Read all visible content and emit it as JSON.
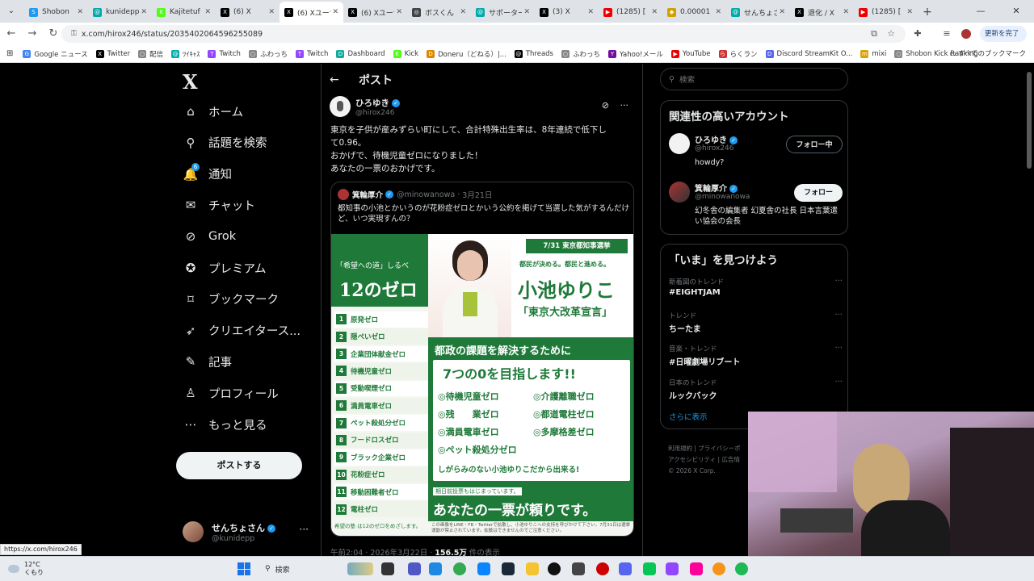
{
  "browser": {
    "tabs": [
      {
        "label": "Shobon",
        "color": "#1d9bf0",
        "glyph": "S"
      },
      {
        "label": "kunidepp",
        "color": "#0aa",
        "glyph": "@"
      },
      {
        "label": "Kajitetuf",
        "color": "#53fc18",
        "glyph": "K"
      },
      {
        "label": "(6) X",
        "color": "#000",
        "glyph": "X"
      },
      {
        "label": "(6) Xユーザ",
        "color": "#000",
        "glyph": "X"
      },
      {
        "label": "(6) Xユーザ",
        "color": "#000",
        "glyph": "X"
      },
      {
        "label": "ボスくん",
        "color": "#444",
        "glyph": "◎"
      },
      {
        "label": "サポーター",
        "color": "#0aa",
        "glyph": "@"
      },
      {
        "label": "(3) X",
        "color": "#000",
        "glyph": "X"
      },
      {
        "label": "(1285) [",
        "color": "#e00",
        "glyph": "▶"
      },
      {
        "label": "0.00001",
        "color": "#d4a000",
        "glyph": "◆"
      },
      {
        "label": "せんちょさ",
        "color": "#0aa",
        "glyph": "@"
      },
      {
        "label": "退化 / X",
        "color": "#000",
        "glyph": "X"
      },
      {
        "label": "(1285) [",
        "color": "#e00",
        "glyph": "▶"
      }
    ],
    "active_tab": 4,
    "url": "x.com/hirox246/status/2035402064596255089",
    "update_label": "更新を完了",
    "bookmarks": [
      {
        "label": "Google ニュース",
        "color": "#4285f4",
        "glyph": "G"
      },
      {
        "label": "Twitter",
        "color": "#000",
        "glyph": "X"
      },
      {
        "label": "配信",
        "color": "#888",
        "glyph": "○"
      },
      {
        "label": "ﾂｲｷｬｽ",
        "color": "#0aa",
        "glyph": "@"
      },
      {
        "label": "Twitch",
        "color": "#9146ff",
        "glyph": "T"
      },
      {
        "label": "ふわっち",
        "color": "#888",
        "glyph": "○"
      },
      {
        "label": "Twitch",
        "color": "#9146ff",
        "glyph": "T"
      },
      {
        "label": "Dashboard",
        "color": "#1a9",
        "glyph": "D"
      },
      {
        "label": "Kick",
        "color": "#53fc18",
        "glyph": "K"
      },
      {
        "label": "Doneru（どねる）|...",
        "color": "#d80",
        "glyph": "D"
      },
      {
        "label": "Threads",
        "color": "#000",
        "glyph": "@"
      },
      {
        "label": "ふわっち",
        "color": "#888",
        "glyph": "○"
      },
      {
        "label": "Yahoo!メール",
        "color": "#720e9e",
        "glyph": "Y"
      },
      {
        "label": "YouTube",
        "color": "#e00",
        "glyph": "▶"
      },
      {
        "label": "らくラン",
        "color": "#c33",
        "glyph": "ら"
      },
      {
        "label": "Discord StreamKit O...",
        "color": "#5865f2",
        "glyph": "D"
      },
      {
        "label": "mixi",
        "color": "#d8a200",
        "glyph": "m"
      },
      {
        "label": "Shobon Kick Ranking",
        "color": "#888",
        "glyph": "○"
      }
    ],
    "all_bookmarks": "すべてのブックマーク",
    "status_url": "https://x.com/hirox246"
  },
  "sidebar": {
    "logo": "X",
    "items": [
      {
        "label": "ホーム",
        "icon": "home-icon",
        "glyph": "⌂"
      },
      {
        "label": "話題を検索",
        "icon": "search-icon",
        "glyph": "⚲"
      },
      {
        "label": "通知",
        "icon": "bell-icon",
        "glyph": "🔔",
        "badge": "6"
      },
      {
        "label": "チャット",
        "icon": "mail-icon",
        "glyph": "✉"
      },
      {
        "label": "Grok",
        "icon": "grok-icon",
        "glyph": "⊘"
      },
      {
        "label": "プレミアム",
        "icon": "premium-icon",
        "glyph": "✪"
      },
      {
        "label": "ブックマーク",
        "icon": "bookmark-icon",
        "glyph": "⌑"
      },
      {
        "label": "クリエイタース...",
        "icon": "rocket-icon",
        "glyph": "➶"
      },
      {
        "label": "記事",
        "icon": "article-icon",
        "glyph": "✎"
      },
      {
        "label": "プロフィール",
        "icon": "profile-icon",
        "glyph": "♙"
      },
      {
        "label": "もっと見る",
        "icon": "more-circle-icon",
        "glyph": "⋯"
      }
    ],
    "post_button": "ポストする",
    "account": {
      "name": "せんちょさん",
      "handle": "@kunidepp"
    }
  },
  "post": {
    "header": "ポスト",
    "author": {
      "name": "ひろゆき",
      "handle": "@hirox246"
    },
    "lines": [
      "東京を子供が産みずらい町にして、合計特殊出生率は、8年連続で低下し",
      "て0.96。",
      "おかげで、待機児童ゼロになりました！",
      "あなたの一票のおかげです。"
    ],
    "quote": {
      "author": {
        "name": "箕輪厚介",
        "handle": "@minowanowa",
        "date": "3月21日"
      },
      "text": "都知事の小池とかいうのが花粉症ゼロとかいう公約を掲げて当選した気がするんだけど、いつ実現すんの？",
      "poster": {
        "left_tag": "「希望への道」しるべ",
        "left_title": "12のゼロ",
        "zeros": [
          "原発ゼロ",
          "隠ぺいゼロ",
          "企業団体献金ゼロ",
          "待機児童ゼロ",
          "受動喫煙ゼロ",
          "満員電車ゼロ",
          "ペット殺処分ゼロ",
          "フードロスゼロ",
          "ブラック企業ゼロ",
          "花粉症ゼロ",
          "移動困難者ゼロ",
          "電柱ゼロ"
        ],
        "left_footer": "希望の塾 は12のゼロをめざします。",
        "election": "7/31 東京都知事選挙",
        "slogan": "都民が決める。都民と進める。",
        "candidate": "小池ゆりこ",
        "declaration": "「東京大改革宣言」",
        "mission": "都政の課題を解決するために",
        "seven": "7つの0を目指します!!",
        "seven_zeros": [
          "◎待機児童ゼロ",
          "◎介護離職ゼロ",
          "◎残　　業ゼロ",
          "◎都道電柱ゼロ",
          "◎満員電車ゼロ",
          "◎多摩格差ゼロ",
          "◎ペット殺処分ゼロ"
        ],
        "tagline": "しがらみのない小池ゆりこだから出来る!",
        "early_vote": "期日前投票もはじまっています。",
        "vote": "あなたの一票が頼りです。",
        "small_note": "この画像をLINE・FB・Twitterで拡散し、小池ゆりこへの支持を呼びかけて下さい。7月31日は選挙運動が禁止されています。拡散はできませんのでご注意ください。"
      }
    },
    "meta": {
      "time": "午前2:04 · 2026年3月22日 ·",
      "views": "156.5万",
      "views_label": "件の表示"
    }
  },
  "right": {
    "search_placeholder": "検索",
    "relevant_title": "関連性の高いアカウント",
    "accounts": [
      {
        "name": "ひろゆき",
        "handle": "@hirox246",
        "bio": "howdy?",
        "button": "フォロー中"
      },
      {
        "name": "箕輪厚介",
        "handle": "@minowanowa",
        "bio": "幻冬舎の編集者 幻夏舎の社長 日本言葉遣い協会の会長",
        "button": "フォロー"
      }
    ],
    "trends_title": "「いま」を見つけよう",
    "trends": [
      {
        "category": "新着図のトレンド",
        "name": "#EIGHTJAM"
      },
      {
        "category": "トレンド",
        "name": "ちーたま"
      },
      {
        "category": "音楽・トレンド",
        "name": "#日曜劇場リブート"
      },
      {
        "category": "日本のトレンド",
        "name": "ルックバック"
      }
    ],
    "show_more": "さらに表示",
    "footer_lines": [
      "利用規約 | プライバシーポ",
      "アクセシビリティ | 広告情",
      "© 2026 X Corp."
    ]
  },
  "taskbar": {
    "temp": "12°C",
    "weather": "くもり",
    "search": "検索"
  }
}
